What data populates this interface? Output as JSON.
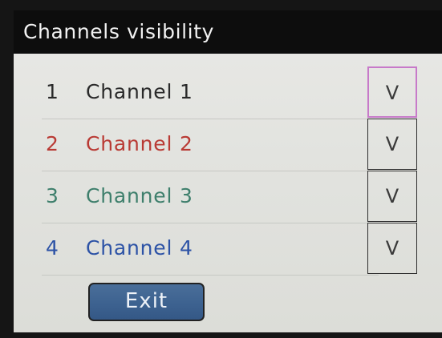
{
  "title": "Channels visibility",
  "channels": [
    {
      "number": "1",
      "name": "Channel 1",
      "visible_mark": "V",
      "color": "#2a2a2a"
    },
    {
      "number": "2",
      "name": "Channel 2",
      "visible_mark": "V",
      "color": "#b93a34"
    },
    {
      "number": "3",
      "name": "Channel 3",
      "visible_mark": "V",
      "color": "#3e7f6c"
    },
    {
      "number": "4",
      "name": "Channel 4",
      "visible_mark": "V",
      "color": "#2d53a6"
    }
  ],
  "focus_color": "#c77ac9",
  "exit_label": "Exit"
}
